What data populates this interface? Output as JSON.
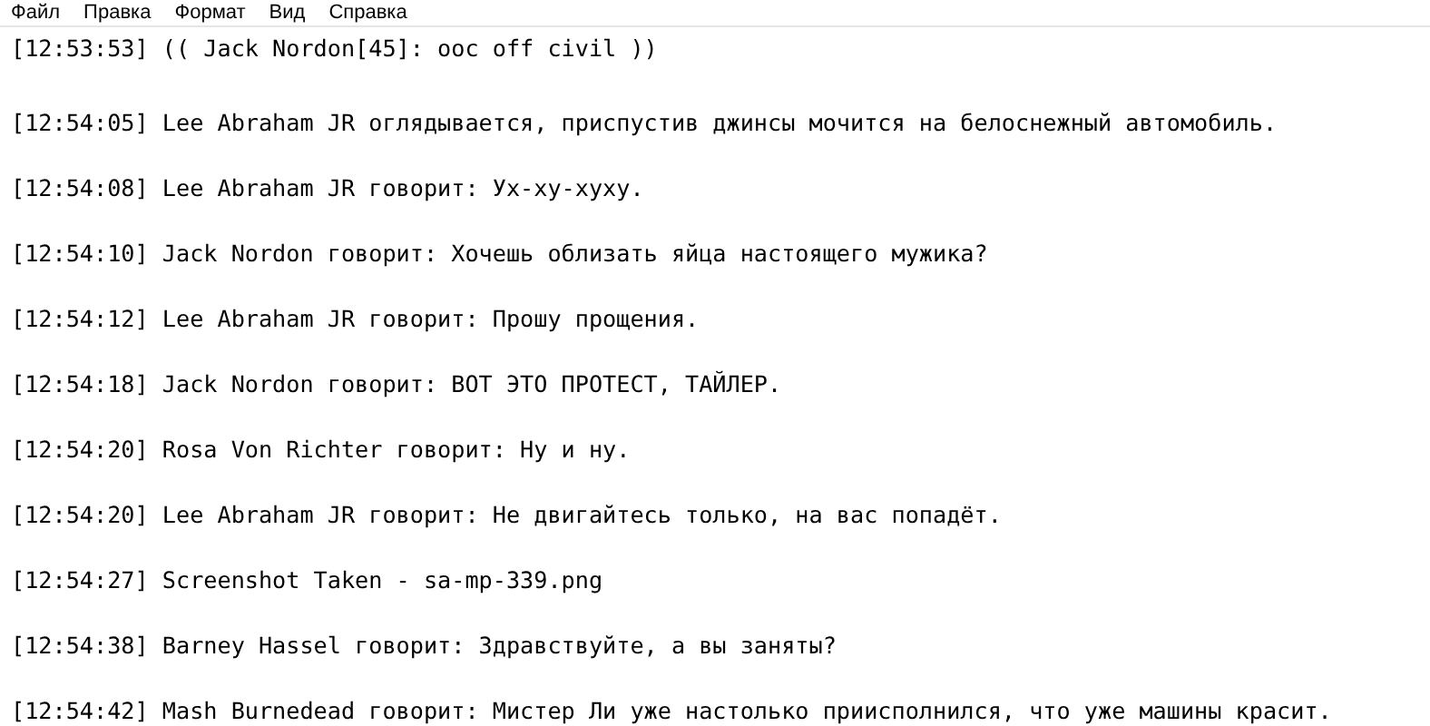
{
  "menu": [
    "Файл",
    "Правка",
    "Формат",
    "Вид",
    "Справка"
  ],
  "lines": [
    "[12:53:53] (( Jack Nordon[45]: ooc off civil ))",
    "[12:54:05] Lee Abraham JR оглядывается, приспустив джинсы мочится на белоснежный автомобиль.",
    "[12:54:08] Lee Abraham JR говорит: Ух-ху-хуху.",
    "[12:54:10] Jack Nordon говорит: Хочешь облизать яйца настоящего мужика?",
    "[12:54:12] Lee Abraham JR говорит: Прошу прощения.",
    "[12:54:18] Jack Nordon говорит: ВОТ ЭТО ПРОТЕСТ, ТАЙЛЕР.",
    "[12:54:20] Rosa Von Richter говорит: Ну и ну.",
    "[12:54:20] Lee Abraham JR говорит: Не двигайтесь только, на вас попадёт.",
    "[12:54:27] Screenshot Taken - sa-mp-339.png",
    "[12:54:38] Barney Hassel говорит: Здравствуйте, а вы заняты?",
    "[12:54:42] Mash Burnedead говорит: Мистер Ли уже настолько приисполнился, что уже машины красит."
  ]
}
